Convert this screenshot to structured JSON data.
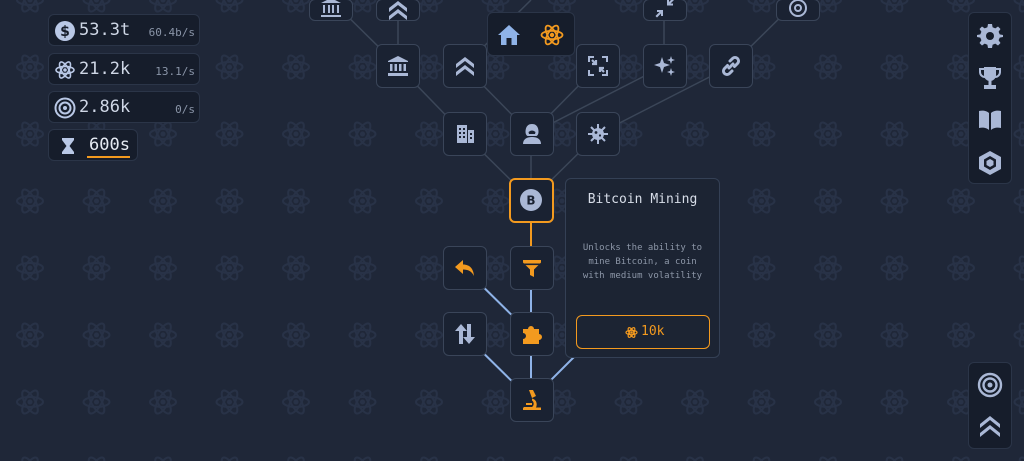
{
  "resources": {
    "money": {
      "value": "53.3t",
      "rate": "60.4b/s",
      "icon": "dollar-coin-icon"
    },
    "research": {
      "value": "21.2k",
      "rate": "13.1/s",
      "icon": "atom-icon"
    },
    "prestige": {
      "value": "2.86k",
      "rate": "0/s",
      "icon": "target-circle-icon"
    },
    "timer": {
      "value": "600s",
      "icon": "hourglass-icon",
      "progress": 1.0
    }
  },
  "tooltip": {
    "title": "Bitcoin Mining",
    "description": "Unlocks the ability to mine Bitcoin, a coin with medium volatility",
    "cost": "10k",
    "cost_icon": "atom-icon"
  },
  "tabs": {
    "home_icon": "home-icon",
    "research_icon": "atom-icon"
  },
  "side_menu": [
    "settings-icon",
    "trophy-icon",
    "book-icon",
    "shield-icon"
  ],
  "side_menu_bottom": [
    "target-circle-icon",
    "chevrons-up-icon"
  ],
  "colors": {
    "accent": "#f39a1f",
    "background": "#1f2738",
    "panel": "#161d2b",
    "icon": "#aab8d6"
  }
}
